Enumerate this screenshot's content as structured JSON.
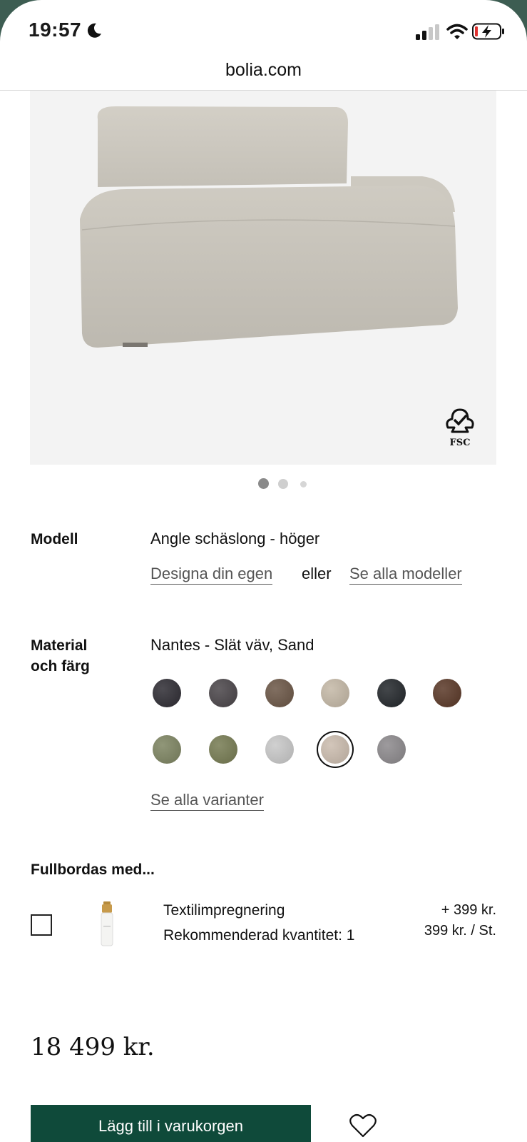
{
  "status_bar": {
    "time": "19:57"
  },
  "browser": {
    "url": "bolia.com"
  },
  "product_image": {
    "badge": "FSC",
    "carousel": {
      "count": 3,
      "active_index": 0
    }
  },
  "model": {
    "label": "Modell",
    "value": "Angle schäslong - höger",
    "design_link": "Designa din egen",
    "or_text": "eller",
    "all_models_link": "Se alla modeller"
  },
  "material": {
    "label_line1": "Material",
    "label_line2": "och färg",
    "value": "Nantes - Slät väv, Sand",
    "swatch_colors": [
      "#2e2c33",
      "#4a4549",
      "#6b5646",
      "#c4b8a6",
      "#23272b",
      "#5a3827",
      "#7d8461",
      "#767b52",
      "#c8c8c8",
      "#cbbcae",
      "#8c898c"
    ],
    "selected_index": 9,
    "all_variants_link": "Se alla varianter"
  },
  "addons": {
    "title": "Fullbordas med...",
    "item": {
      "name": "Textilimpregnering",
      "quantity_text": "Rekommenderad kvantitet: 1",
      "price": "+ 399 kr.",
      "unit_price": "399 kr. / St.",
      "checked": false
    }
  },
  "price": "18 499 kr.",
  "cart_button": "Lägg till i varukorgen",
  "colors": {
    "accent": "#0f4a3a"
  }
}
